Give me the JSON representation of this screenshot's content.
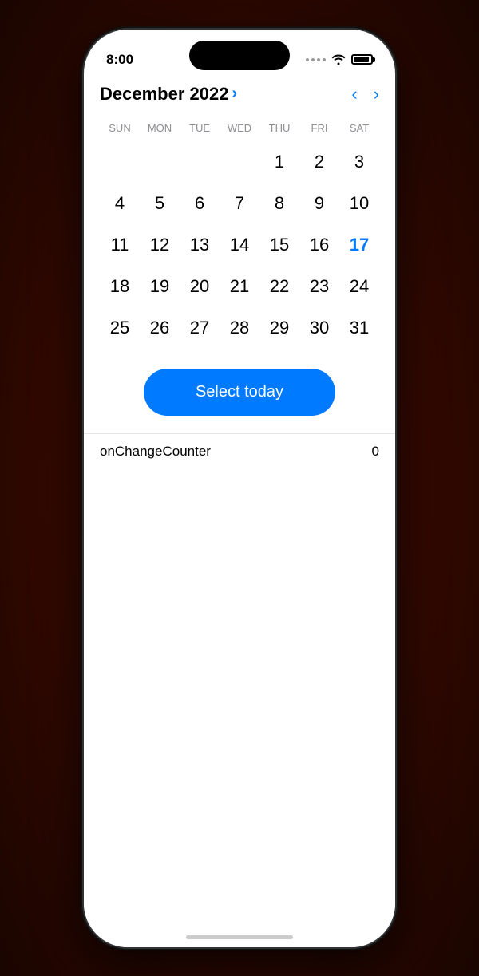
{
  "status": {
    "time": "8:00",
    "signal": "dots",
    "wifi": "wifi",
    "battery": "battery"
  },
  "header": {
    "month_title": "December 2022",
    "month_chevron": "›",
    "prev_label": "‹",
    "next_label": "›"
  },
  "day_names": [
    "SUN",
    "MON",
    "TUE",
    "WED",
    "THU",
    "FRI",
    "SAT"
  ],
  "weeks": [
    [
      null,
      null,
      null,
      null,
      "1",
      "2",
      "3"
    ],
    [
      "4",
      "5",
      "6",
      "7",
      "8",
      "9",
      "10"
    ],
    [
      "11",
      "12",
      "13",
      "14",
      "15",
      "16",
      "17"
    ],
    [
      "18",
      "19",
      "20",
      "21",
      "22",
      "23",
      "24"
    ],
    [
      "25",
      "26",
      "27",
      "28",
      "29",
      "30",
      "31"
    ]
  ],
  "today_date": "17",
  "select_today_btn": "Select today",
  "counter": {
    "label": "onChangeCounter",
    "value": "0"
  }
}
